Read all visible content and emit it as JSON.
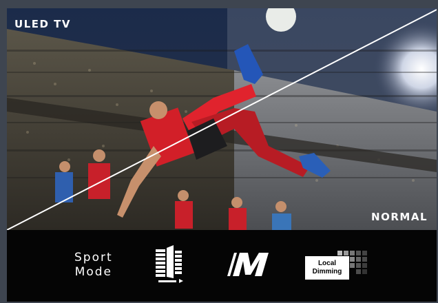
{
  "screen": {
    "label_left": "ULED TV",
    "label_right": "NORMAL"
  },
  "features": {
    "sport_line1": "Sport",
    "sport_line2": "Mode",
    "local_dimming_line1": "Local",
    "local_dimming_line2": "Dimming"
  },
  "icons": [
    "sport-mode-text",
    "motion-icon",
    "m-logo-icon",
    "local-dimming-icon"
  ]
}
